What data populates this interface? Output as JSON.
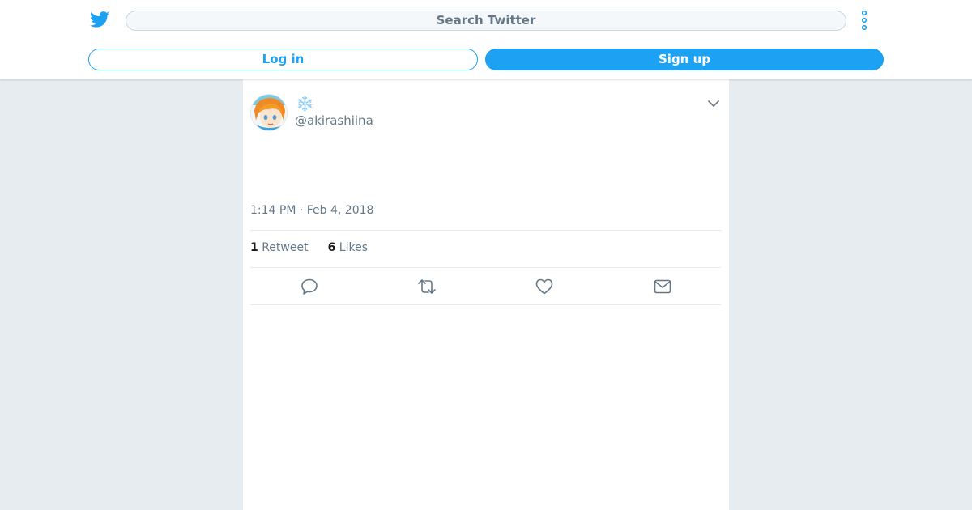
{
  "header": {
    "logo_icon": "twitter-bird-icon",
    "search_placeholder": "Search Twitter",
    "more_icon": "more-vertical-icon",
    "login_label": "Log in",
    "signup_label": "Sign up",
    "accent_color": "#1da1f2"
  },
  "tweet": {
    "avatar_icon": "user-avatar",
    "display_name": "❄️",
    "handle": "@akirashiina",
    "timestamp": "1:14 PM · Feb 4, 2018",
    "retweet_count": "1",
    "retweet_label": "Retweet",
    "like_count": "6",
    "like_label": "Likes",
    "actions": [
      "reply-icon",
      "retweet-icon",
      "like-icon",
      "message-icon"
    ]
  },
  "colors": {
    "background": "#e6ecf0",
    "muted_text": "#657786"
  }
}
